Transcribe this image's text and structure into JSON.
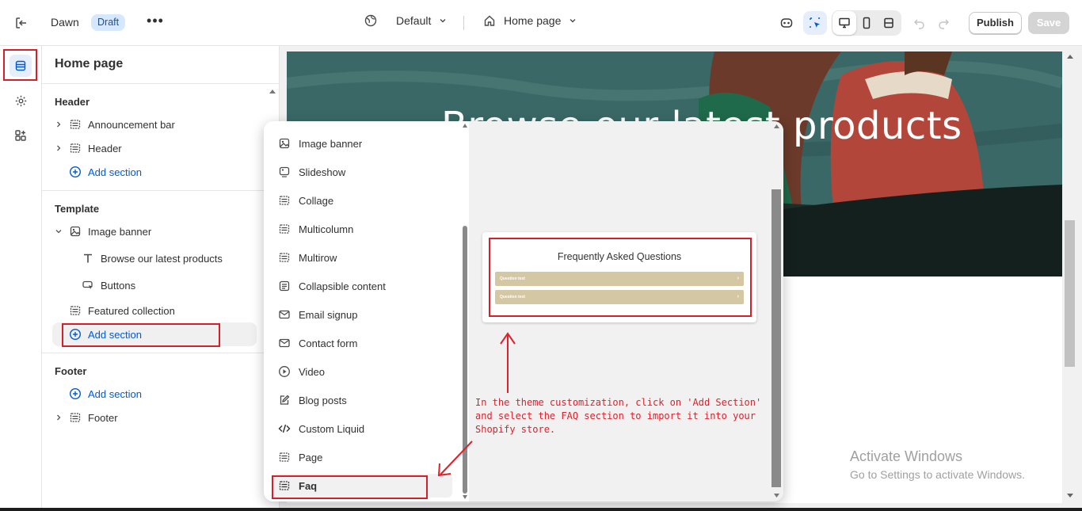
{
  "topbar": {
    "theme_name": "Dawn",
    "status_badge": "Draft",
    "preset_label": "Default",
    "page_label": "Home page",
    "publish_label": "Publish",
    "save_label": "Save"
  },
  "sidebar": {
    "title": "Home page",
    "header_group": {
      "title": "Header",
      "items": [
        {
          "label": "Announcement bar",
          "icon": "section-icon"
        },
        {
          "label": "Header",
          "icon": "section-icon"
        }
      ],
      "add_label": "Add section"
    },
    "template_group": {
      "title": "Template",
      "image_banner": "Image banner",
      "children": [
        {
          "label": "Browse our latest products",
          "icon": "text-icon"
        },
        {
          "label": "Buttons",
          "icon": "button-icon"
        }
      ],
      "featured_collection": "Featured collection",
      "add_label": "Add section"
    },
    "footer_group": {
      "title": "Footer",
      "add_label": "Add section",
      "footer_label": "Footer"
    }
  },
  "preview": {
    "hero_title": "Browse our latest products"
  },
  "popover": {
    "sections": [
      {
        "label": "Image banner",
        "icon": "image-icon"
      },
      {
        "label": "Slideshow",
        "icon": "slideshow-icon"
      },
      {
        "label": "Collage",
        "icon": "section-icon"
      },
      {
        "label": "Multicolumn",
        "icon": "section-icon"
      },
      {
        "label": "Multirow",
        "icon": "section-icon"
      },
      {
        "label": "Collapsible content",
        "icon": "collapsible-icon"
      },
      {
        "label": "Email signup",
        "icon": "email-icon"
      },
      {
        "label": "Contact form",
        "icon": "email-icon"
      },
      {
        "label": "Video",
        "icon": "play-icon"
      },
      {
        "label": "Blog posts",
        "icon": "edit-icon"
      },
      {
        "label": "Custom Liquid",
        "icon": "code-icon"
      },
      {
        "label": "Page",
        "icon": "section-icon"
      },
      {
        "label": "Faq",
        "icon": "section-icon"
      }
    ],
    "faq_preview": {
      "title": "Frequently Asked Questions",
      "questions": [
        "Question text",
        "Question text"
      ]
    }
  },
  "annotation": {
    "note": "In the theme customization, click on 'Add Section' and select the FAQ section to import it into your Shopify store."
  },
  "watermark": {
    "line1": "Activate Windows",
    "line2": "Go to Settings to activate Windows."
  },
  "colors": {
    "accent": "#005bd3",
    "annotation_red": "#d5202a",
    "faq_question_bar": "#d4c7a4",
    "hero_bg": "#3b6b69"
  }
}
